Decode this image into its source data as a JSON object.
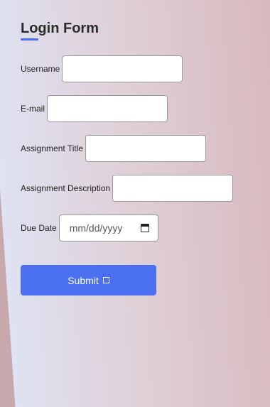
{
  "form": {
    "title": "Login Form",
    "fields": {
      "username": {
        "label": "Username",
        "value": ""
      },
      "email": {
        "label": "E-mail",
        "value": ""
      },
      "assignment_title": {
        "label": "Assignment Title",
        "value": ""
      },
      "assignment_description": {
        "label": "Assignment Description",
        "value": ""
      },
      "due_date": {
        "label": "Due Date",
        "placeholder": "mm/dd/yyyy"
      }
    },
    "submit_label": "Submit"
  },
  "icons": {
    "calendar": "calendar-icon",
    "submit": "square-icon"
  },
  "colors": {
    "accent": "#4a6ff0",
    "button_text": "#ffffff"
  }
}
